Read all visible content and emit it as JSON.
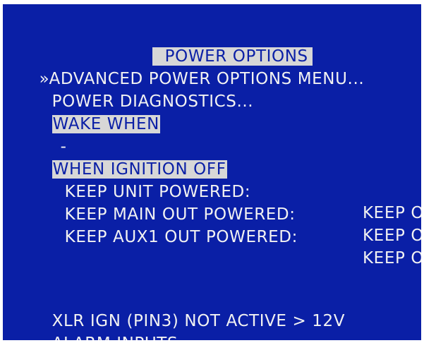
{
  "menu": {
    "title": "POWER OPTIONS",
    "cursor_glyph": "»",
    "items": {
      "advanced": "ADVANCED POWER OPTIONS MENU...",
      "diagnostics": "POWER DIAGNOSTICS...",
      "wake_when_header": "WAKE WHEN",
      "wake_when_value": "-",
      "ignition_off_header": "WHEN IGNITION OFF",
      "keep_unit_label": "KEEP UNIT POWERED:",
      "keep_unit_value": "KEEP ON",
      "keep_main_label": "KEEP MAIN OUT POWERED:",
      "keep_main_value": "KEEP ON",
      "keep_aux1_label": "KEEP AUX1 OUT POWERED:",
      "keep_aux1_value": "KEEP ON",
      "xlr_ign": "XLR IGN (PIN3) NOT ACTIVE > 12V",
      "alarm_inputs": "ALARM INPUTS"
    }
  },
  "colors": {
    "background": "#0a1fa6",
    "text": "#f2f2f2",
    "highlight": "#d7d7d7"
  }
}
